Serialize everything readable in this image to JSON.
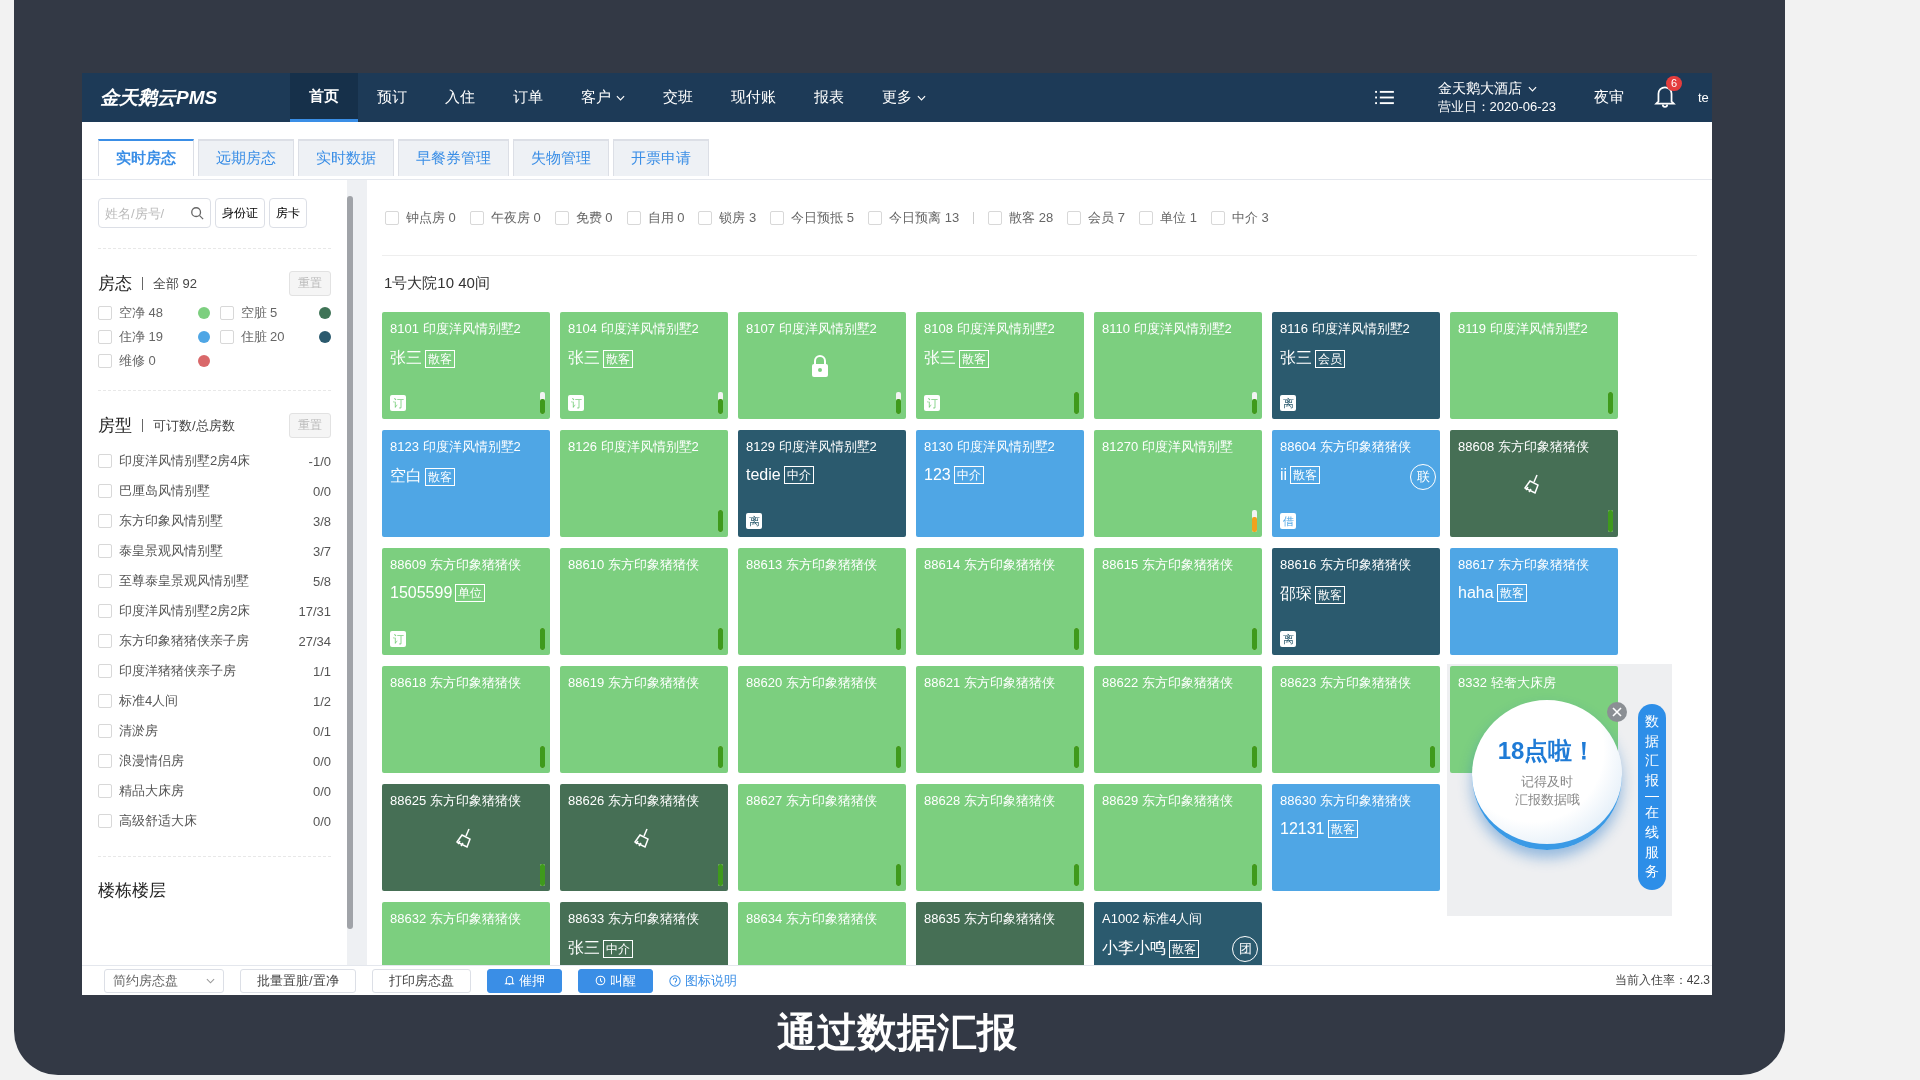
{
  "nav": {
    "logo": "金天鹅云PMS",
    "items": [
      {
        "label": "首页",
        "selected": true,
        "dropdown": false
      },
      {
        "label": "预订",
        "selected": false,
        "dropdown": false
      },
      {
        "label": "入住",
        "selected": false,
        "dropdown": false
      },
      {
        "label": "订单",
        "selected": false,
        "dropdown": false
      },
      {
        "label": "客户",
        "selected": false,
        "dropdown": true
      },
      {
        "label": "交班",
        "selected": false,
        "dropdown": false
      },
      {
        "label": "现付账",
        "selected": false,
        "dropdown": false
      },
      {
        "label": "报表",
        "selected": false,
        "dropdown": false
      },
      {
        "label": "更多",
        "selected": false,
        "dropdown": true
      }
    ],
    "hotel": "金天鹅大酒店",
    "business_day": "营业日：2020-06-23",
    "night_audit": "夜审",
    "notifications": "6",
    "user": "te"
  },
  "tabs": [
    {
      "label": "实时房态",
      "selected": true
    },
    {
      "label": "远期房态",
      "selected": false
    },
    {
      "label": "实时数据",
      "selected": false
    },
    {
      "label": "早餐券管理",
      "selected": false
    },
    {
      "label": "失物管理",
      "selected": false
    },
    {
      "label": "开票申请",
      "selected": false
    }
  ],
  "sidebar": {
    "search": {
      "placeholder": "姓名/房号/"
    },
    "buttons": [
      "身份证",
      "房卡"
    ],
    "status": {
      "title": "房态",
      "summary": "全部 92",
      "reset": "重置",
      "items": [
        {
          "label": "空净 48",
          "color": "#7ccf7f",
          "checked": false
        },
        {
          "label": "空脏 5",
          "color": "#3f7356",
          "checked": false
        },
        {
          "label": "住净 19",
          "color": "#4fa6e5",
          "checked": false
        },
        {
          "label": "住脏 20",
          "color": "#2b5a6e",
          "checked": false
        },
        {
          "label": "维修 0",
          "color": "#d9686a",
          "checked": false
        }
      ]
    },
    "room_types": {
      "title": "房型",
      "summary": "可订数/总房数",
      "reset": "重置",
      "items": [
        {
          "name": "印度洋风情别墅2房4床",
          "count": "-1/0",
          "checked": false
        },
        {
          "name": "巴厘岛风情别墅",
          "count": "0/0",
          "checked": false
        },
        {
          "name": "东方印象风情别墅",
          "count": "3/8",
          "checked": false
        },
        {
          "name": "泰皇景观风情别墅",
          "count": "3/7",
          "checked": false
        },
        {
          "name": "至尊泰皇景观风情别墅",
          "count": "5/8",
          "checked": false
        },
        {
          "name": "印度洋风情别墅2房2床",
          "count": "17/31",
          "checked": false
        },
        {
          "name": "东方印象猪猪侠亲子房",
          "count": "27/34",
          "checked": false
        },
        {
          "name": "印度洋猪猪侠亲子房",
          "count": "1/1",
          "checked": false
        },
        {
          "name": "标准4人间",
          "count": "1/2",
          "checked": false
        },
        {
          "name": "清淤房",
          "count": "0/1",
          "checked": false
        },
        {
          "name": "浪漫情侣房",
          "count": "0/0",
          "checked": false
        },
        {
          "name": "精品大床房",
          "count": "0/0",
          "checked": false
        },
        {
          "name": "高级舒适大床",
          "count": "0/0",
          "checked": false
        }
      ]
    },
    "buildings": {
      "title": "楼栋楼层"
    }
  },
  "filters": {
    "status": [
      {
        "label": "钟点房 0",
        "checked": false
      },
      {
        "label": "午夜房 0",
        "checked": false
      },
      {
        "label": "免费 0",
        "checked": false
      },
      {
        "label": "自用 0",
        "checked": false
      },
      {
        "label": "锁房 3",
        "checked": false
      },
      {
        "label": "今日预抵 5",
        "checked": false
      },
      {
        "label": "今日预离 13",
        "checked": false
      }
    ],
    "source": [
      {
        "label": "散客 28",
        "checked": false
      },
      {
        "label": "会员 7",
        "checked": false
      },
      {
        "label": "单位 1",
        "checked": false
      },
      {
        "label": "中介 3",
        "checked": false
      }
    ]
  },
  "building": {
    "title": "1号大院10 40间",
    "rows": [
      [
        {
          "title": "8101 印度洋风情别墅2",
          "kind": "plain",
          "color": "#7ccf7f",
          "guest": "张三",
          "tag": "散客",
          "badge": "订",
          "meter": {
            "level": 0.7,
            "color": "#3f9a1c"
          }
        },
        {
          "title": "8104 印度洋风情别墅2",
          "kind": "plain",
          "color": "#7ccf7f",
          "guest": "张三",
          "tag": "散客",
          "badge": "订",
          "meter": {
            "level": 0.7,
            "color": "#3f9a1c"
          }
        },
        {
          "title": "8107 印度洋风情别墅2",
          "kind": "locked",
          "color": "#7ccf7f",
          "meter": {
            "level": 0.7,
            "color": "#3f9a1c"
          }
        },
        {
          "title": "8108 印度洋风情别墅2",
          "kind": "plain",
          "color": "#7ccf7f",
          "guest": "张三",
          "tag": "散客",
          "badge": "订",
          "meter": {
            "level": 1,
            "color": "#3f9a1c"
          }
        },
        {
          "title": "8110 印度洋风情别墅2",
          "kind": "plain",
          "color": "#7ccf7f",
          "meter": {
            "level": 0.7,
            "color": "#3f9a1c"
          }
        },
        {
          "title": "8116 印度洋风情别墅2",
          "kind": "plain",
          "color": "#2b5a6e",
          "guest": "张三",
          "tag": "会员",
          "badge": "离"
        },
        {
          "title": "8119 印度洋风情别墅2",
          "kind": "plain",
          "color": "#7ccf7f",
          "meter": {
            "level": 1,
            "color": "#3f9a1c"
          }
        }
      ],
      [
        {
          "title": "8123 印度洋风情别墅2",
          "kind": "plain",
          "color": "#4fa6e5",
          "guest": "空白",
          "tag": "散客"
        },
        {
          "title": "8126 印度洋风情别墅2",
          "kind": "plain",
          "color": "#7ccf7f",
          "meter": {
            "level": 1,
            "color": "#3f9a1c"
          }
        },
        {
          "title": "8129 印度洋风情别墅2",
          "kind": "plain",
          "color": "#2b5a6e",
          "guest": "tedie",
          "tag": "中介",
          "badge": "离"
        },
        {
          "title": "8130 印度洋风情别墅2",
          "kind": "plain",
          "color": "#4fa6e5",
          "guest": "123",
          "tag": "中介"
        },
        {
          "title": "81270 印度洋风情别墅",
          "kind": "plain",
          "color": "#7ccf7f",
          "meter": {
            "level": 0.7,
            "color": "#f0a21d"
          }
        },
        {
          "title": "88604 东方印象猪猪侠",
          "kind": "plain",
          "color": "#4fa6e5",
          "guest": "ii",
          "tag": "散客",
          "badge": "借",
          "corner": "联"
        },
        {
          "title": "88608 东方印象猪猪侠",
          "kind": "cleaning",
          "color": "#466f55",
          "meter": {
            "level": 1,
            "color": "#3f9a1c"
          }
        }
      ],
      [
        {
          "title": "88609 东方印象猪猪侠",
          "kind": "plain",
          "color": "#7ccf7f",
          "guest": "1505599",
          "tag": "单位",
          "badge": "订",
          "meter": {
            "level": 1,
            "color": "#3f9a1c"
          }
        },
        {
          "title": "88610 东方印象猪猪侠",
          "kind": "plain",
          "color": "#7ccf7f",
          "meter": {
            "level": 1,
            "color": "#3f9a1c"
          }
        },
        {
          "title": "88613 东方印象猪猪侠",
          "kind": "plain",
          "color": "#7ccf7f",
          "meter": {
            "level": 1,
            "color": "#3f9a1c"
          }
        },
        {
          "title": "88614 东方印象猪猪侠",
          "kind": "plain",
          "color": "#7ccf7f",
          "meter": {
            "level": 1,
            "color": "#3f9a1c"
          }
        },
        {
          "title": "88615 东方印象猪猪侠",
          "kind": "plain",
          "color": "#7ccf7f",
          "meter": {
            "level": 1,
            "color": "#3f9a1c"
          }
        },
        {
          "title": "88616 东方印象猪猪侠",
          "kind": "plain",
          "color": "#2b5a6e",
          "guest": "邵琛",
          "tag": "散客",
          "badge": "离"
        },
        {
          "title": "88617 东方印象猪猪侠",
          "kind": "plain",
          "color": "#4fa6e5",
          "guest": "haha",
          "tag": "散客"
        }
      ],
      [
        {
          "title": "88618 东方印象猪猪侠",
          "kind": "plain",
          "color": "#7ccf7f",
          "meter": {
            "level": 1,
            "color": "#3f9a1c"
          }
        },
        {
          "title": "88619 东方印象猪猪侠",
          "kind": "plain",
          "color": "#7ccf7f",
          "meter": {
            "level": 1,
            "color": "#3f9a1c"
          }
        },
        {
          "title": "88620 东方印象猪猪侠",
          "kind": "plain",
          "color": "#7ccf7f",
          "meter": {
            "level": 1,
            "color": "#3f9a1c"
          }
        },
        {
          "title": "88621 东方印象猪猪侠",
          "kind": "plain",
          "color": "#7ccf7f",
          "meter": {
            "level": 1,
            "color": "#3f9a1c"
          }
        },
        {
          "title": "88622 东方印象猪猪侠",
          "kind": "plain",
          "color": "#7ccf7f",
          "meter": {
            "level": 1,
            "color": "#3f9a1c"
          }
        },
        {
          "title": "88623 东方印象猪猪侠",
          "kind": "plain",
          "color": "#7ccf7f",
          "meter": {
            "level": 1,
            "color": "#3f9a1c"
          }
        },
        {
          "title": "8332 轻奢大床房",
          "kind": "plain",
          "color": "#7ccf7f"
        }
      ],
      [
        {
          "title": "88625 东方印象猪猪侠",
          "kind": "cleaning",
          "color": "#466f55",
          "meter": {
            "level": 1,
            "color": "#3f9a1c"
          }
        },
        {
          "title": "88626 东方印象猪猪侠",
          "kind": "cleaning",
          "color": "#466f55",
          "meter": {
            "level": 1,
            "color": "#3f9a1c"
          }
        },
        {
          "title": "88627 东方印象猪猪侠",
          "kind": "plain",
          "color": "#7ccf7f",
          "meter": {
            "level": 1,
            "color": "#3f9a1c"
          }
        },
        {
          "title": "88628 东方印象猪猪侠",
          "kind": "plain",
          "color": "#7ccf7f",
          "meter": {
            "level": 1,
            "color": "#3f9a1c"
          }
        },
        {
          "title": "88629 东方印象猪猪侠",
          "kind": "plain",
          "color": "#7ccf7f",
          "meter": {
            "level": 1,
            "color": "#3f9a1c"
          }
        },
        {
          "title": "88630 东方印象猪猪侠",
          "kind": "plain",
          "color": "#4fa6e5",
          "guest": "12131",
          "tag": "散客"
        }
      ],
      [
        {
          "title": "88632 东方印象猪猪侠",
          "kind": "plain",
          "color": "#7ccf7f"
        },
        {
          "title": "88633 东方印象猪猪侠",
          "kind": "plain",
          "color": "#466f55",
          "guest": "张三",
          "tag": "中介"
        },
        {
          "title": "88634 东方印象猪猪侠",
          "kind": "plain",
          "color": "#7ccf7f"
        },
        {
          "title": "88635 东方印象猪猪侠",
          "kind": "plain",
          "color": "#466f55"
        },
        {
          "title": "A1002 标准4人间",
          "kind": "plain",
          "color": "#2b5a6e",
          "guest": "小李小鸣",
          "tag": "散客",
          "corner": "团"
        }
      ]
    ]
  },
  "popup": {
    "headline": "18点啦！",
    "lines": [
      "记得及时",
      "汇报数据哦"
    ]
  },
  "side_tab": [
    "数据汇报",
    "在线服务"
  ],
  "footer": {
    "view_select": "简约房态盘",
    "buttons": [
      {
        "label": "批量置脏/置净",
        "kind": "plain"
      },
      {
        "label": "打印房态盘",
        "kind": "plain"
      },
      {
        "label": "催押",
        "kind": "deposit"
      },
      {
        "label": "叫醒",
        "kind": "wakeup"
      }
    ],
    "help": "图标说明",
    "occupancy": "当前入住率：42.3"
  },
  "subtitle": "通过数据汇报"
}
